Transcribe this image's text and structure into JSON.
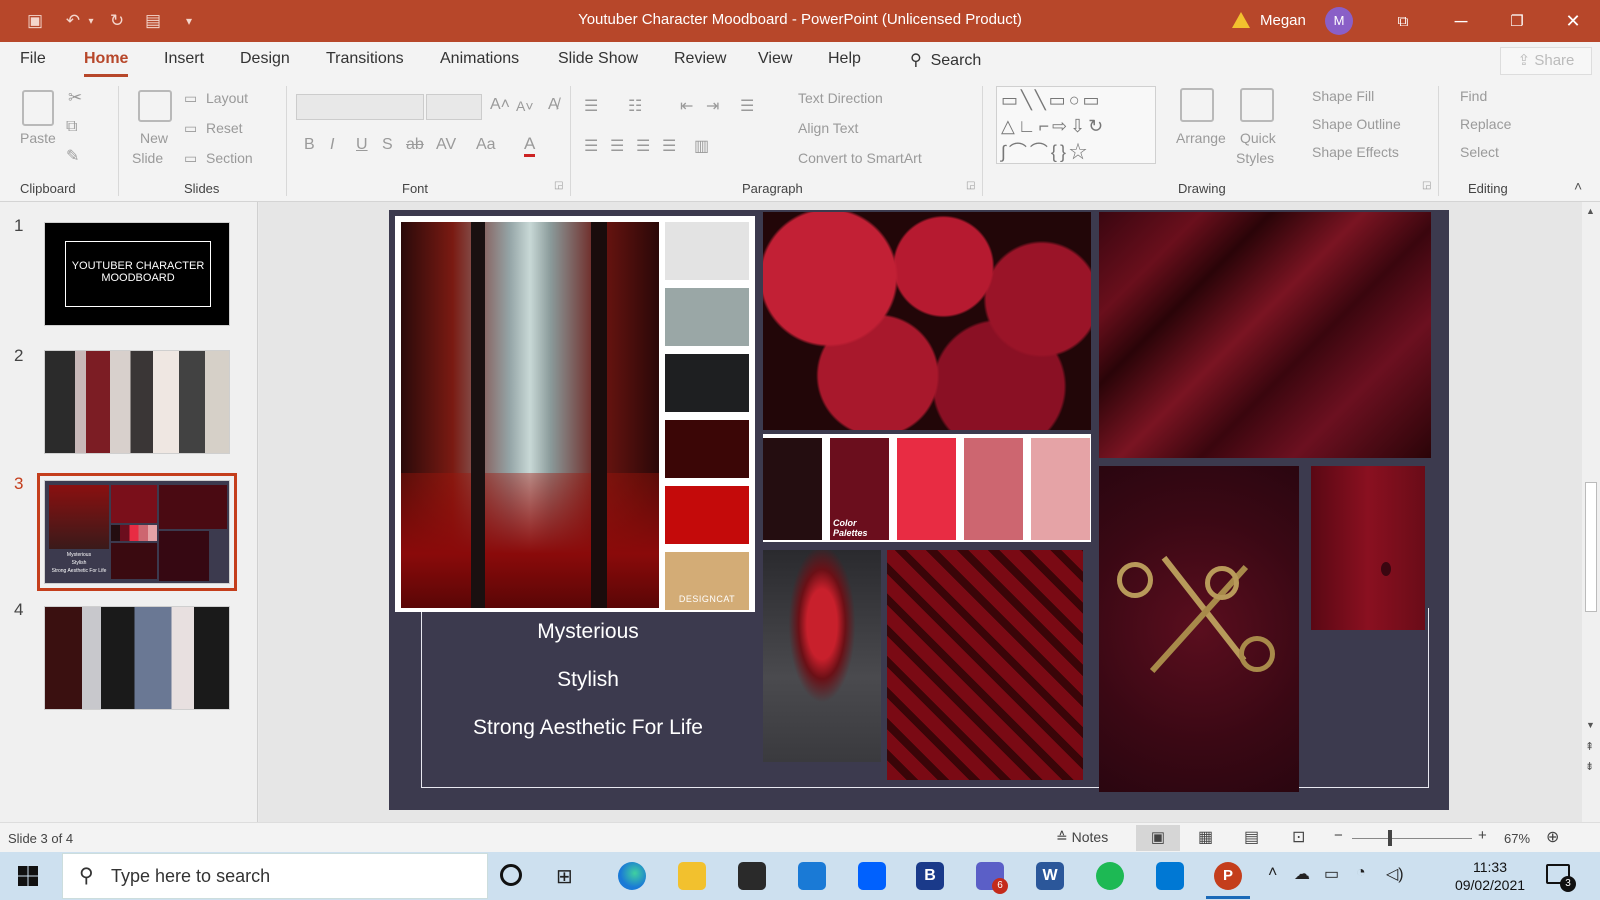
{
  "titlebar": {
    "title": "Youtuber Character Moodboard  -  PowerPoint (Unlicensed Product)",
    "user": "Megan",
    "avatar_initial": "M",
    "accent": "#b7472a"
  },
  "tabs": [
    "File",
    "Home",
    "Insert",
    "Design",
    "Transitions",
    "Animations",
    "Slide Show",
    "Review",
    "View",
    "Help"
  ],
  "search_label": "Search",
  "share_label": "Share",
  "ribbon": {
    "clipboard": {
      "label": "Clipboard",
      "paste": "Paste"
    },
    "slides": {
      "label": "Slides",
      "new": "New",
      "slide": "Slide",
      "layout": "Layout",
      "reset": "Reset",
      "section": "Section"
    },
    "font": {
      "label": "Font",
      "bold": "B",
      "italic": "I",
      "underline": "U",
      "shadow": "S",
      "strike": "ab",
      "spacing": "AV",
      "case": "Aa",
      "color": "A"
    },
    "paragraph": {
      "label": "Paragraph",
      "text_direction": "Text Direction",
      "align_text": "Align Text",
      "convert": "Convert to SmartArt"
    },
    "drawing": {
      "label": "Drawing",
      "arrange": "Arrange",
      "quick": "Quick",
      "styles": "Styles",
      "fill": "Shape Fill",
      "outline": "Shape Outline",
      "effects": "Shape Effects"
    },
    "editing": {
      "label": "Editing",
      "find": "Find",
      "replace": "Replace",
      "select": "Select"
    }
  },
  "slides": [
    {
      "num": "1",
      "title": "YOUTUBER CHARACTER MOODBOARD"
    },
    {
      "num": "2"
    },
    {
      "num": "3",
      "mini_words": [
        "Mysterious",
        "Stylish",
        "Strong Aesthetic For Life"
      ]
    },
    {
      "num": "4"
    }
  ],
  "current_slide": {
    "words": [
      "Mysterious",
      "Stylish",
      "Strong Aesthetic For Life"
    ],
    "palette_colors": [
      "#e3e3e3",
      "#9aa7a6",
      "#1e1f21",
      "#3b0606",
      "#c40a0a",
      "#d3ac76"
    ],
    "brand_tag": "DESIGNCAT",
    "strip_colors": [
      "#240d10",
      "#6b0e1d",
      "#e82c43",
      "#cd6670",
      "#e5a3a6"
    ],
    "strip_label": "Color Palettes"
  },
  "status": {
    "slide_of": "Slide 3 of 4",
    "notes": "Notes",
    "zoom": "67%"
  },
  "taskbar": {
    "search_placeholder": "Type here to search",
    "time": "11:33",
    "date": "09/02/2021",
    "notif_count": "3",
    "teams_badge": "6",
    "b_label": "B",
    "w_label": "W",
    "p_label": "P"
  }
}
